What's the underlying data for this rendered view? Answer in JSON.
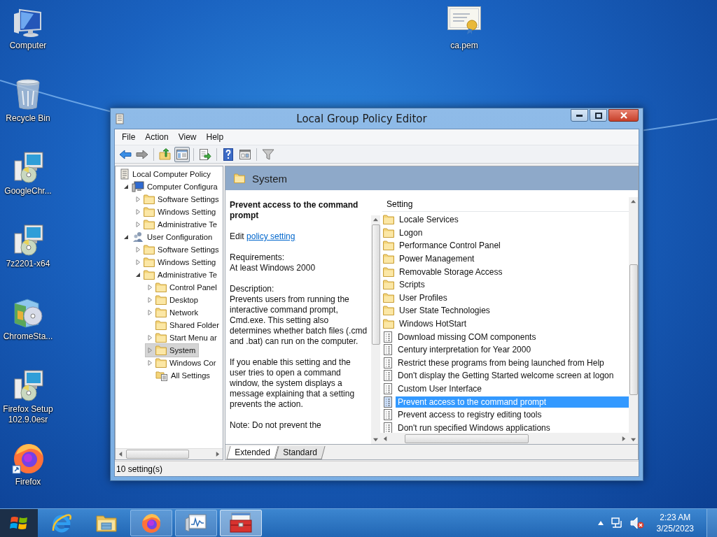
{
  "desktop_icons": [
    {
      "label": "Computer",
      "kind": "computer"
    },
    {
      "label": "Recycle Bin",
      "kind": "recycle-bin"
    },
    {
      "label": "GoogleChr...",
      "kind": "installer"
    },
    {
      "label": "7z2201-x64",
      "kind": "installer"
    },
    {
      "label": "ChromeSta...",
      "kind": "package"
    },
    {
      "label": "Firefox Setup 102.9.0esr",
      "kind": "installer"
    },
    {
      "label": "Firefox",
      "kind": "firefox"
    }
  ],
  "desktop_file": {
    "label": "ca.pem",
    "kind": "certificate"
  },
  "window": {
    "title": "Local Group Policy Editor",
    "menu": [
      "File",
      "Action",
      "View",
      "Help"
    ],
    "toolbar": [
      {
        "kind": "back",
        "pressed": false
      },
      {
        "kind": "forward",
        "pressed": false
      },
      {
        "kind": "separator"
      },
      {
        "kind": "up",
        "pressed": false
      },
      {
        "kind": "tree-pane",
        "pressed": true
      },
      {
        "kind": "separator"
      },
      {
        "kind": "export",
        "pressed": false
      },
      {
        "kind": "separator"
      },
      {
        "kind": "help",
        "pressed": false
      },
      {
        "kind": "view-pane",
        "pressed": false
      },
      {
        "kind": "separator"
      },
      {
        "kind": "filter",
        "pressed": false
      }
    ],
    "tree": [
      {
        "label": "Local Computer Policy",
        "kind": "policy",
        "selected": false,
        "children": [
          {
            "label": "Computer Configura",
            "kind": "computer",
            "expandable": true,
            "expanded": true,
            "selected": false,
            "children": [
              {
                "label": "Software Settings",
                "kind": "folder",
                "expandable": true,
                "expanded": false,
                "selected": false
              },
              {
                "label": "Windows Setting",
                "kind": "folder",
                "expandable": true,
                "expanded": false,
                "selected": false
              },
              {
                "label": "Administrative Te",
                "kind": "folder",
                "expandable": true,
                "expanded": false,
                "selected": false
              }
            ]
          },
          {
            "label": "User Configuration",
            "kind": "users",
            "expandable": true,
            "expanded": true,
            "selected": false,
            "children": [
              {
                "label": "Software Settings",
                "kind": "folder",
                "expandable": true,
                "expanded": false,
                "selected": false
              },
              {
                "label": "Windows Setting",
                "kind": "folder",
                "expandable": true,
                "expanded": false,
                "selected": false
              },
              {
                "label": "Administrative Te",
                "kind": "folder",
                "expandable": true,
                "expanded": true,
                "selected": false,
                "children": [
                  {
                    "label": "Control Panel",
                    "kind": "folder",
                    "expandable": true,
                    "expanded": false,
                    "selected": false
                  },
                  {
                    "label": "Desktop",
                    "kind": "folder",
                    "expandable": true,
                    "expanded": false,
                    "selected": false
                  },
                  {
                    "label": "Network",
                    "kind": "folder",
                    "expandable": true,
                    "expanded": false,
                    "selected": false
                  },
                  {
                    "label": "Shared Folder",
                    "kind": "folder",
                    "expandable": false,
                    "selected": false
                  },
                  {
                    "label": "Start Menu ar",
                    "kind": "folder",
                    "expandable": true,
                    "expanded": false,
                    "selected": false
                  },
                  {
                    "label": "System",
                    "kind": "folder",
                    "expandable": true,
                    "expanded": false,
                    "selected": true
                  },
                  {
                    "label": "Windows Cor",
                    "kind": "folder",
                    "expandable": true,
                    "expanded": false,
                    "selected": false
                  },
                  {
                    "label": "All Settings",
                    "kind": "all-settings",
                    "expandable": false,
                    "selected": false
                  }
                ]
              }
            ]
          }
        ]
      }
    ],
    "header": {
      "title": "System"
    },
    "description": {
      "title": "Prevent access to the command prompt",
      "edit_prefix": "Edit",
      "edit_link": "policy setting",
      "requirements_label": "Requirements:",
      "requirements_value": "At least Windows 2000",
      "description_label": "Description:",
      "paragraphs": [
        "Prevents users from running the interactive command prompt, Cmd.exe. This setting also determines whether batch files (.cmd and .bat) can run on the computer.",
        "If you enable this setting and the user tries to open a command window, the system displays a message explaining that a setting prevents the action.",
        "Note: Do not prevent the"
      ]
    },
    "settings": {
      "column": "Setting",
      "rows": [
        {
          "label": "Locale Services",
          "kind": "folder",
          "selected": false
        },
        {
          "label": "Logon",
          "kind": "folder",
          "selected": false
        },
        {
          "label": "Performance Control Panel",
          "kind": "folder",
          "selected": false
        },
        {
          "label": "Power Management",
          "kind": "folder",
          "selected": false
        },
        {
          "label": "Removable Storage Access",
          "kind": "folder",
          "selected": false
        },
        {
          "label": "Scripts",
          "kind": "folder",
          "selected": false
        },
        {
          "label": "User Profiles",
          "kind": "folder",
          "selected": false
        },
        {
          "label": "User State Technologies",
          "kind": "folder",
          "selected": false
        },
        {
          "label": "Windows HotStart",
          "kind": "folder",
          "selected": false
        },
        {
          "label": "Download missing COM components",
          "kind": "policy",
          "selected": false
        },
        {
          "label": "Century interpretation for Year 2000",
          "kind": "policy",
          "selected": false
        },
        {
          "label": "Restrict these programs from being launched from Help",
          "kind": "policy",
          "selected": false
        },
        {
          "label": "Don't display the Getting Started welcome screen at logon",
          "kind": "policy",
          "selected": false
        },
        {
          "label": "Custom User Interface",
          "kind": "policy",
          "selected": false
        },
        {
          "label": "Prevent access to the command prompt",
          "kind": "policy",
          "selected": true
        },
        {
          "label": "Prevent access to registry editing tools",
          "kind": "policy",
          "selected": false
        },
        {
          "label": "Don't run specified Windows applications",
          "kind": "policy",
          "selected": false
        }
      ]
    },
    "view_tabs": [
      {
        "label": "Extended",
        "selected": true
      },
      {
        "label": "Standard",
        "selected": false
      }
    ],
    "status": "10 setting(s)"
  },
  "taskbar": {
    "apps": [
      {
        "kind": "ie",
        "running": false,
        "active": false
      },
      {
        "kind": "explorer",
        "running": false,
        "active": false
      },
      {
        "kind": "firefox",
        "running": true,
        "active": false
      },
      {
        "kind": "perfmon",
        "running": true,
        "active": false
      },
      {
        "kind": "gpedit",
        "running": true,
        "active": true
      }
    ],
    "volume_muted": true,
    "clock": {
      "time": "2:23 AM",
      "date": "3/25/2023"
    }
  }
}
